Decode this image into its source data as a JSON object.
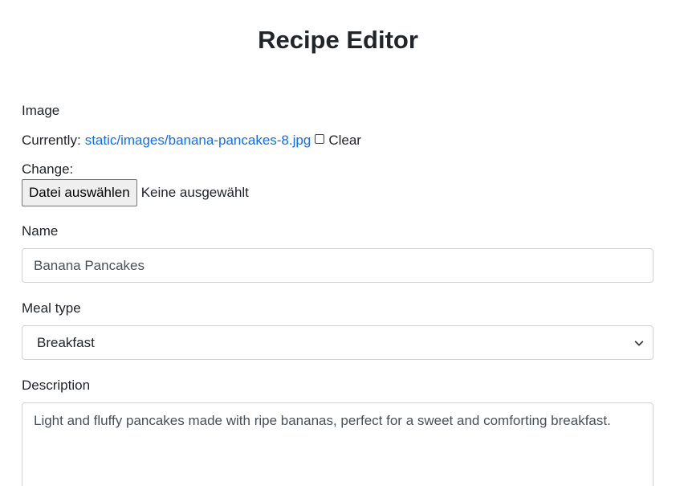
{
  "page": {
    "title": "Recipe Editor"
  },
  "image": {
    "label": "Image",
    "currently_label": "Currently:",
    "current_file": "static/images/banana-pancakes-8.jpg",
    "clear_label": "Clear",
    "clear_checked": false,
    "change_label": "Change:",
    "file_button_label": "Datei auswählen",
    "file_status": "Keine ausgewählt"
  },
  "name": {
    "label": "Name",
    "value": "Banana Pancakes"
  },
  "meal_type": {
    "label": "Meal type",
    "selected": "Breakfast"
  },
  "description": {
    "label": "Description",
    "value": "Light and fluffy pancakes made with ripe bananas, perfect for a sweet and comforting breakfast."
  },
  "colors": {
    "link": "#0d6efd",
    "text": "#212529",
    "border": "#ced4da"
  },
  "icons": {
    "select_arrow": "chevron-down-icon",
    "clear_checkbox": "checkbox-icon"
  }
}
